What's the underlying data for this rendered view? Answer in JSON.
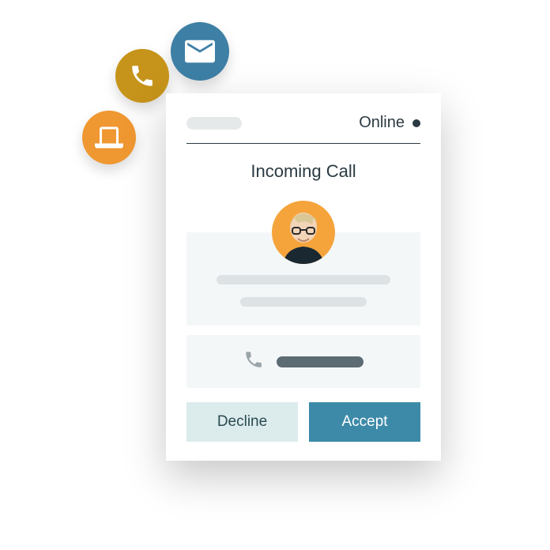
{
  "status": {
    "label": "Online"
  },
  "title": "Incoming Call",
  "buttons": {
    "decline": "Decline",
    "accept": "Accept"
  },
  "icons": {
    "floating": [
      "mail-icon",
      "phone-icon",
      "laptop-icon"
    ],
    "inline_phone": "phone-icon"
  },
  "colors": {
    "mail_bg": "#3d7fa5",
    "phone_bg": "#c6941a",
    "laptop_bg": "#ef9731",
    "accept_bg": "#3d8aa8",
    "decline_bg": "#dcebec",
    "avatar_bg": "#f5a43c"
  }
}
